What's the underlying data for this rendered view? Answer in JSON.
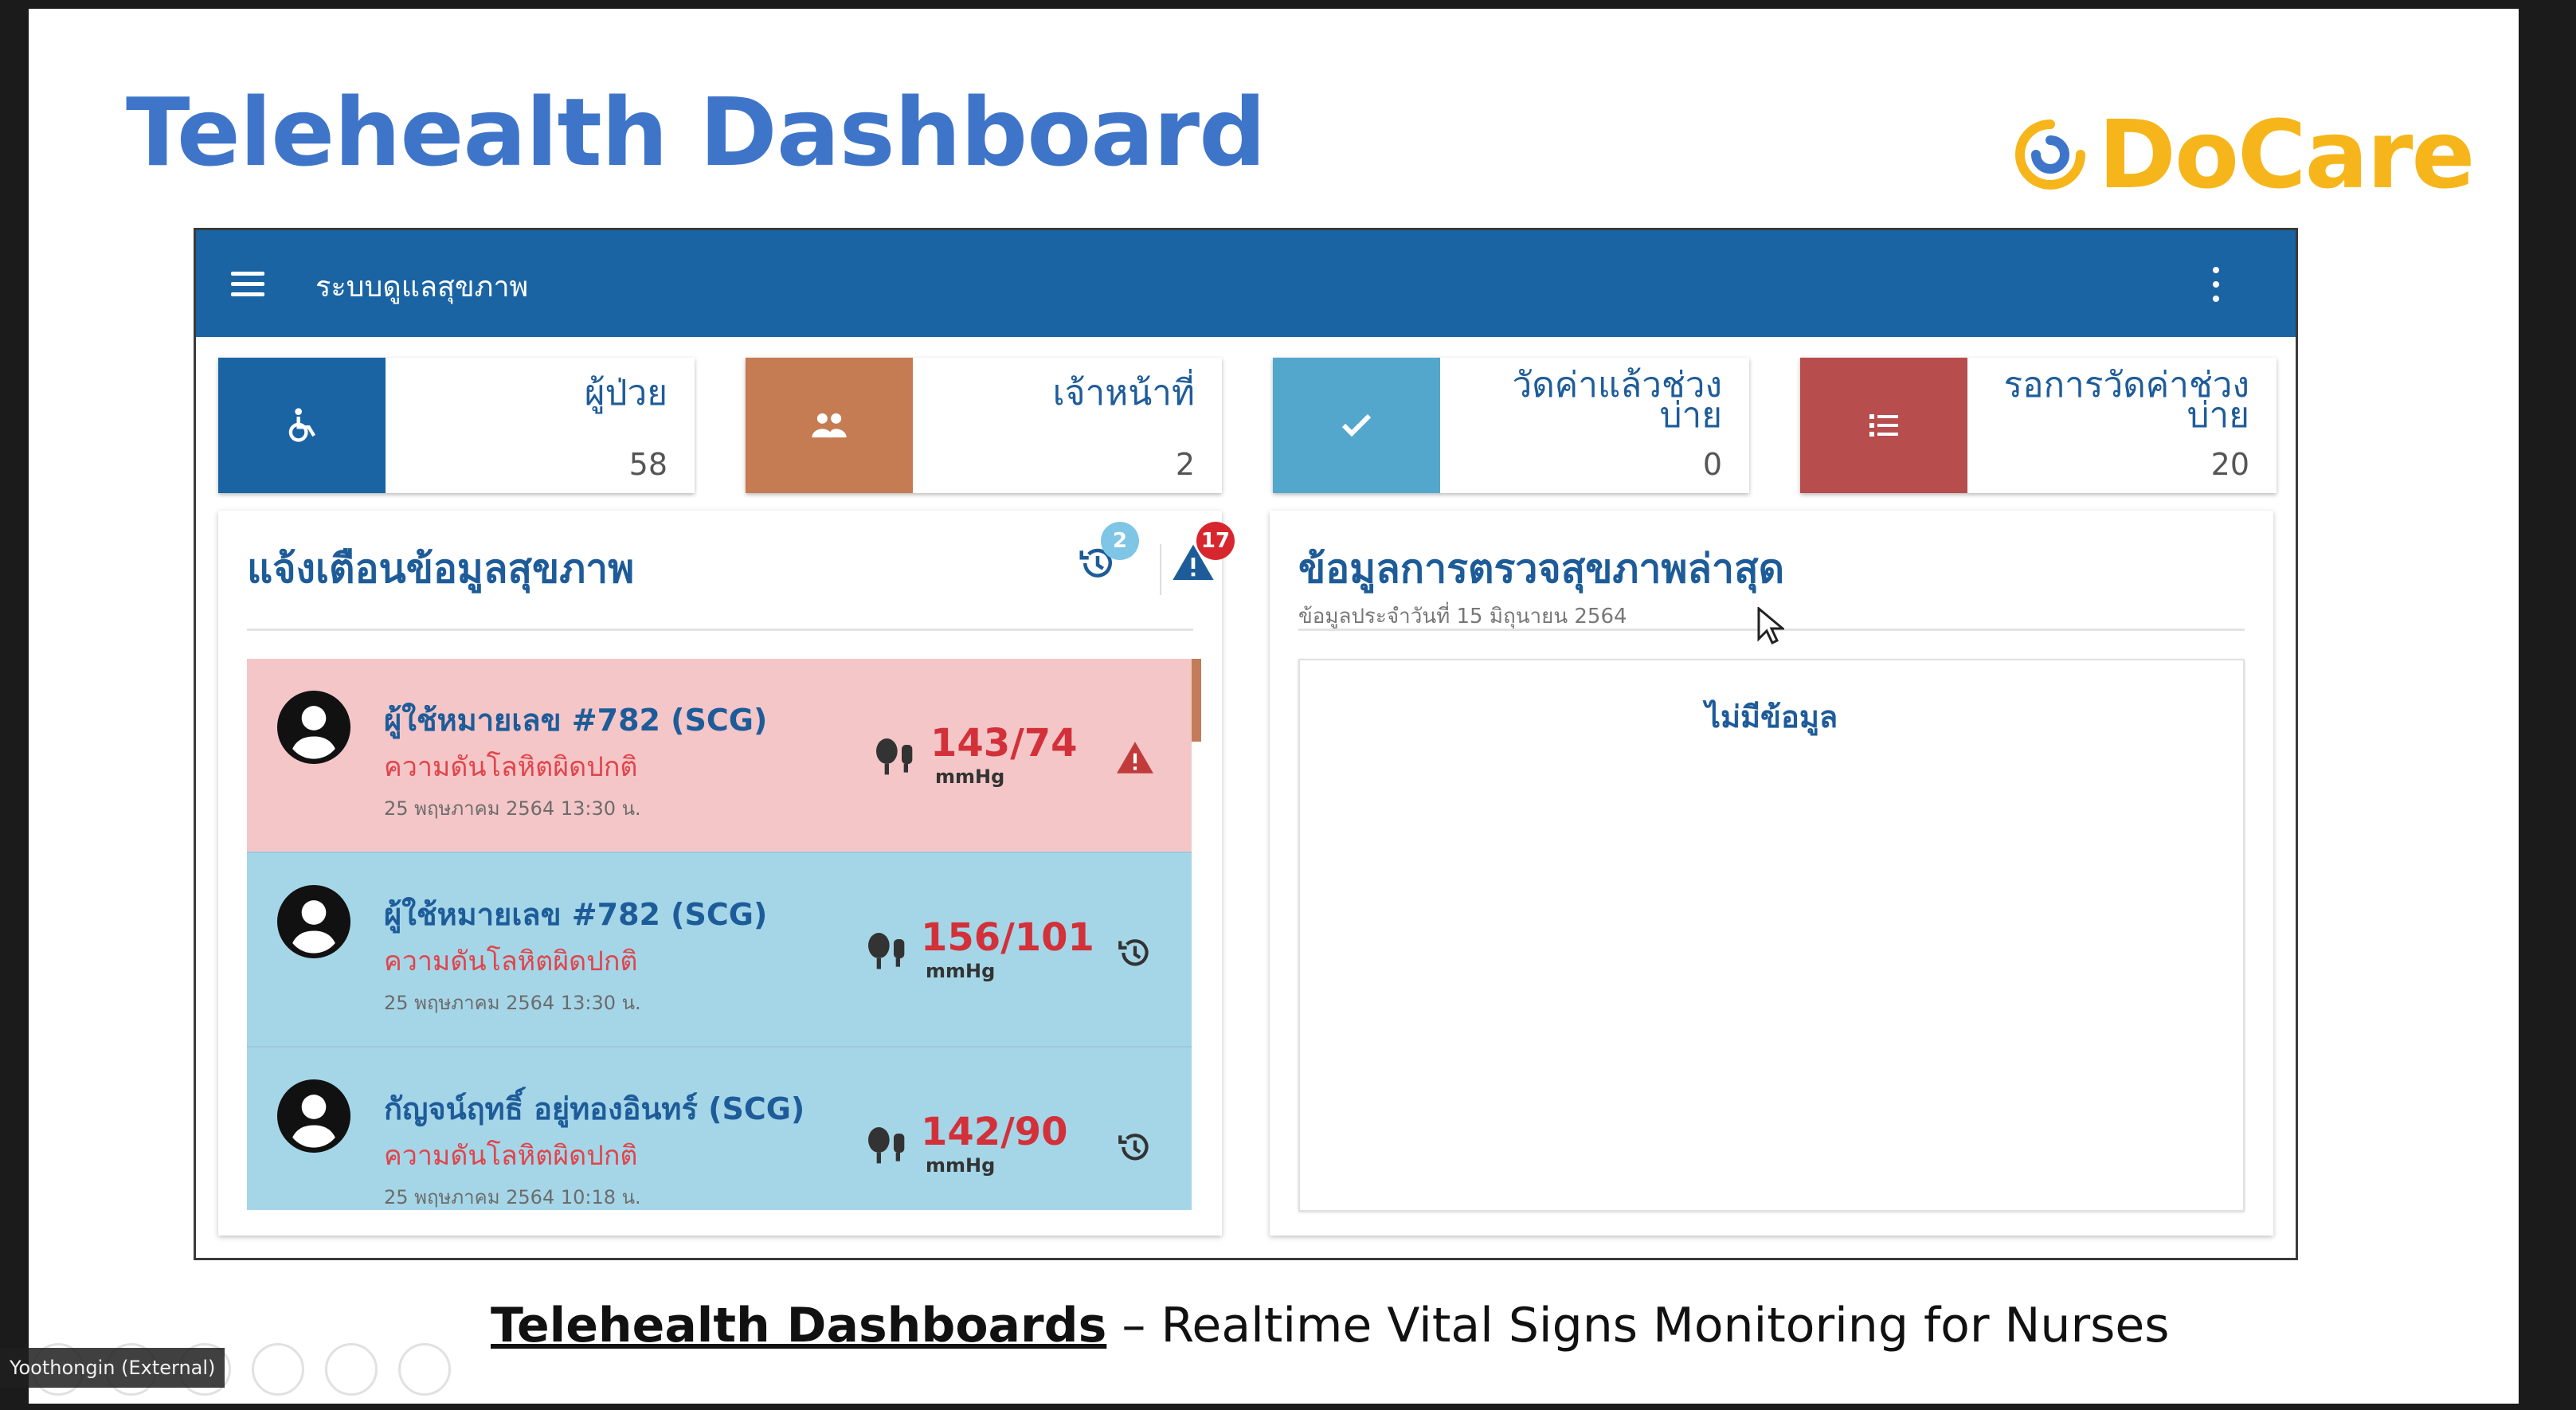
{
  "slide": {
    "title": "Telehealth Dashboard",
    "brand": "DoCare",
    "caption_bold": "Telehealth Dashboards",
    "caption_rest": " – Realtime Vital Signs Monitoring for Nurses"
  },
  "app": {
    "title": "ระบบดูแลสุขภาพ",
    "stats": [
      {
        "label": "ผู้ป่วย",
        "count": "58",
        "color": "#1b64a4",
        "icon": "wheelchair-icon"
      },
      {
        "label": "เจ้าหน้าที่",
        "count": "2",
        "color": "#c57c52",
        "icon": "people-icon"
      },
      {
        "label": "วัดค่าแล้วช่วงบ่าย",
        "count": "0",
        "color": "#53a7cc",
        "icon": "check-icon"
      },
      {
        "label": "รอการวัดค่าช่วงบ่าย",
        "count": "20",
        "color": "#b84d4d",
        "icon": "list-icon"
      }
    ],
    "alerts_panel": {
      "title": "แจ้งเตือนข้อมูลสุขภาพ",
      "history_badge": "2",
      "warning_badge": "17",
      "items": [
        {
          "name": "ผู้ใช้หมายเลข #782 (SCG)",
          "status": "ความดันโลหิตผิดปกติ",
          "time": "25 พฤษภาคม 2564 13:30 น.",
          "bp": "143/74",
          "unit": "mmHg",
          "action_icon": "warning-icon"
        },
        {
          "name": "ผู้ใช้หมายเลข #782 (SCG)",
          "status": "ความดันโลหิตผิดปกติ",
          "time": "25 พฤษภาคม 2564 13:30 น.",
          "bp": "156/101",
          "unit": "mmHg",
          "action_icon": "history-icon"
        },
        {
          "name": "กัญจน์ฤทธิ์ อยู่ทองอินทร์ (SCG)",
          "status": "ความดันโลหิตผิดปกติ",
          "time": "25 พฤษภาคม 2564 10:18 น.",
          "bp": "142/90",
          "unit": "mmHg",
          "action_icon": "history-icon"
        }
      ]
    },
    "latest_panel": {
      "title": "ข้อมูลการตรวจสุขภาพล่าสุด",
      "subtitle": "ข้อมูลประจำวันที่ 15 มิถุนายน 2564",
      "empty_text": "ไม่มีข้อมูล"
    }
  },
  "meeting": {
    "participant": "Yoothongin (External)"
  },
  "colors": {
    "primary": "#1b64a4",
    "title_blue": "#3f75c9",
    "brand_orange": "#f6b61b",
    "alert_red": "#d2313a"
  }
}
